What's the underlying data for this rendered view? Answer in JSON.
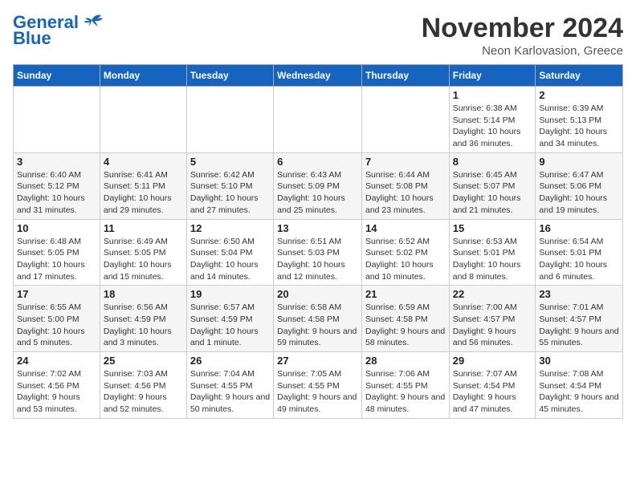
{
  "logo": {
    "line1": "General",
    "line2": "Blue"
  },
  "header": {
    "month": "November 2024",
    "location": "Neon Karlovasion, Greece"
  },
  "days_of_week": [
    "Sunday",
    "Monday",
    "Tuesday",
    "Wednesday",
    "Thursday",
    "Friday",
    "Saturday"
  ],
  "weeks": [
    [
      {
        "day": "",
        "info": ""
      },
      {
        "day": "",
        "info": ""
      },
      {
        "day": "",
        "info": ""
      },
      {
        "day": "",
        "info": ""
      },
      {
        "day": "",
        "info": ""
      },
      {
        "day": "1",
        "info": "Sunrise: 6:38 AM\nSunset: 5:14 PM\nDaylight: 10 hours and 36 minutes."
      },
      {
        "day": "2",
        "info": "Sunrise: 6:39 AM\nSunset: 5:13 PM\nDaylight: 10 hours and 34 minutes."
      }
    ],
    [
      {
        "day": "3",
        "info": "Sunrise: 6:40 AM\nSunset: 5:12 PM\nDaylight: 10 hours and 31 minutes."
      },
      {
        "day": "4",
        "info": "Sunrise: 6:41 AM\nSunset: 5:11 PM\nDaylight: 10 hours and 29 minutes."
      },
      {
        "day": "5",
        "info": "Sunrise: 6:42 AM\nSunset: 5:10 PM\nDaylight: 10 hours and 27 minutes."
      },
      {
        "day": "6",
        "info": "Sunrise: 6:43 AM\nSunset: 5:09 PM\nDaylight: 10 hours and 25 minutes."
      },
      {
        "day": "7",
        "info": "Sunrise: 6:44 AM\nSunset: 5:08 PM\nDaylight: 10 hours and 23 minutes."
      },
      {
        "day": "8",
        "info": "Sunrise: 6:45 AM\nSunset: 5:07 PM\nDaylight: 10 hours and 21 minutes."
      },
      {
        "day": "9",
        "info": "Sunrise: 6:47 AM\nSunset: 5:06 PM\nDaylight: 10 hours and 19 minutes."
      }
    ],
    [
      {
        "day": "10",
        "info": "Sunrise: 6:48 AM\nSunset: 5:05 PM\nDaylight: 10 hours and 17 minutes."
      },
      {
        "day": "11",
        "info": "Sunrise: 6:49 AM\nSunset: 5:05 PM\nDaylight: 10 hours and 15 minutes."
      },
      {
        "day": "12",
        "info": "Sunrise: 6:50 AM\nSunset: 5:04 PM\nDaylight: 10 hours and 14 minutes."
      },
      {
        "day": "13",
        "info": "Sunrise: 6:51 AM\nSunset: 5:03 PM\nDaylight: 10 hours and 12 minutes."
      },
      {
        "day": "14",
        "info": "Sunrise: 6:52 AM\nSunset: 5:02 PM\nDaylight: 10 hours and 10 minutes."
      },
      {
        "day": "15",
        "info": "Sunrise: 6:53 AM\nSunset: 5:01 PM\nDaylight: 10 hours and 8 minutes."
      },
      {
        "day": "16",
        "info": "Sunrise: 6:54 AM\nSunset: 5:01 PM\nDaylight: 10 hours and 6 minutes."
      }
    ],
    [
      {
        "day": "17",
        "info": "Sunrise: 6:55 AM\nSunset: 5:00 PM\nDaylight: 10 hours and 5 minutes."
      },
      {
        "day": "18",
        "info": "Sunrise: 6:56 AM\nSunset: 4:59 PM\nDaylight: 10 hours and 3 minutes."
      },
      {
        "day": "19",
        "info": "Sunrise: 6:57 AM\nSunset: 4:59 PM\nDaylight: 10 hours and 1 minute."
      },
      {
        "day": "20",
        "info": "Sunrise: 6:58 AM\nSunset: 4:58 PM\nDaylight: 9 hours and 59 minutes."
      },
      {
        "day": "21",
        "info": "Sunrise: 6:59 AM\nSunset: 4:58 PM\nDaylight: 9 hours and 58 minutes."
      },
      {
        "day": "22",
        "info": "Sunrise: 7:00 AM\nSunset: 4:57 PM\nDaylight: 9 hours and 56 minutes."
      },
      {
        "day": "23",
        "info": "Sunrise: 7:01 AM\nSunset: 4:57 PM\nDaylight: 9 hours and 55 minutes."
      }
    ],
    [
      {
        "day": "24",
        "info": "Sunrise: 7:02 AM\nSunset: 4:56 PM\nDaylight: 9 hours and 53 minutes."
      },
      {
        "day": "25",
        "info": "Sunrise: 7:03 AM\nSunset: 4:56 PM\nDaylight: 9 hours and 52 minutes."
      },
      {
        "day": "26",
        "info": "Sunrise: 7:04 AM\nSunset: 4:55 PM\nDaylight: 9 hours and 50 minutes."
      },
      {
        "day": "27",
        "info": "Sunrise: 7:05 AM\nSunset: 4:55 PM\nDaylight: 9 hours and 49 minutes."
      },
      {
        "day": "28",
        "info": "Sunrise: 7:06 AM\nSunset: 4:55 PM\nDaylight: 9 hours and 48 minutes."
      },
      {
        "day": "29",
        "info": "Sunrise: 7:07 AM\nSunset: 4:54 PM\nDaylight: 9 hours and 47 minutes."
      },
      {
        "day": "30",
        "info": "Sunrise: 7:08 AM\nSunset: 4:54 PM\nDaylight: 9 hours and 45 minutes."
      }
    ]
  ]
}
